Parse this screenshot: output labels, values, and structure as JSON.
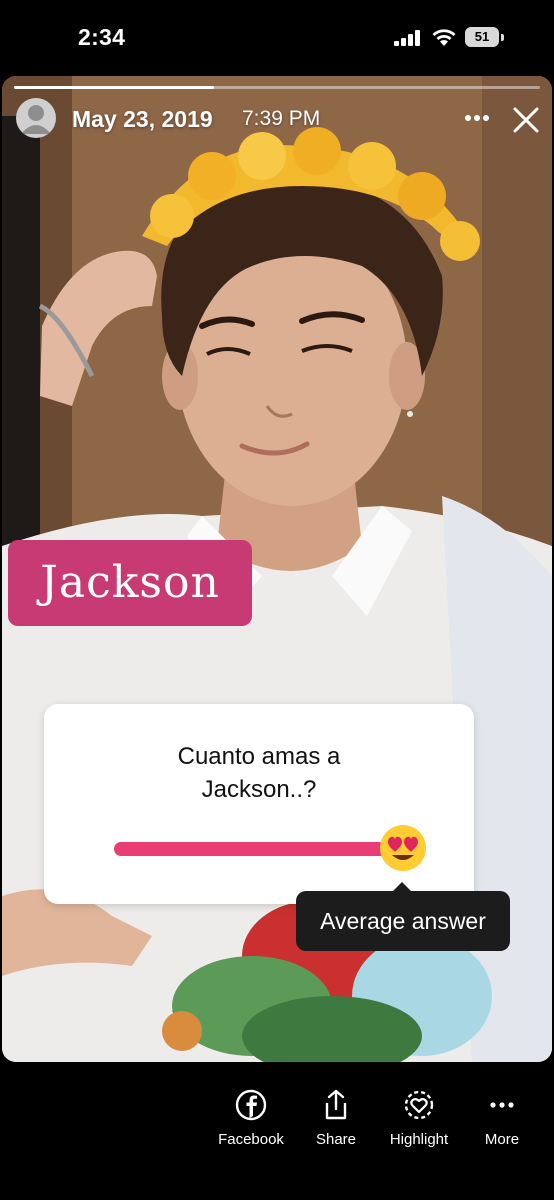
{
  "status_bar": {
    "time": "2:34",
    "battery_level": "51"
  },
  "story": {
    "progress": 0.38,
    "date": "May 23, 2019",
    "time": "7:39 PM",
    "name_sticker": "Jackson",
    "slider": {
      "question": "Cuanto amas a Jackson..?",
      "value": 1.0,
      "emoji": "heart-eyes-emoji",
      "accent_color": "#e93e73"
    },
    "tooltip": "Average answer"
  },
  "toolbar": {
    "items": [
      {
        "label": "Facebook",
        "icon": "facebook-icon"
      },
      {
        "label": "Share",
        "icon": "share-icon"
      },
      {
        "label": "Highlight",
        "icon": "highlight-icon"
      },
      {
        "label": "More",
        "icon": "more-icon"
      }
    ]
  }
}
